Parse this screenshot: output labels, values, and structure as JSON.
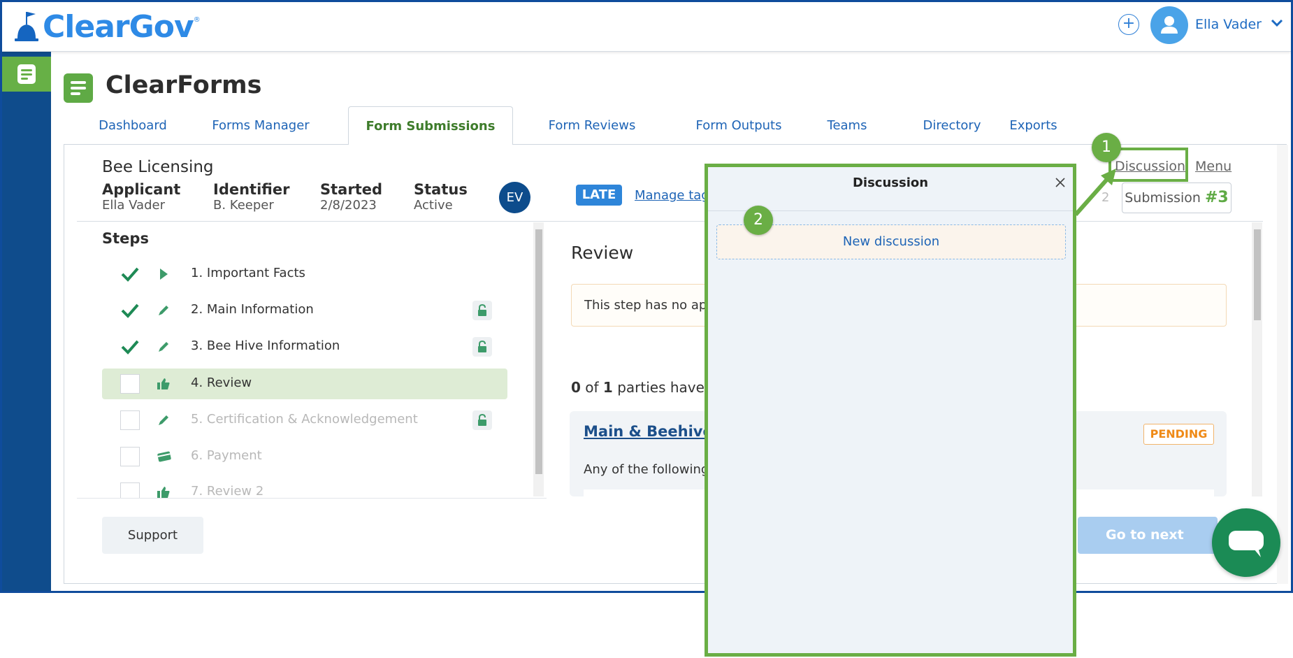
{
  "brand": {
    "name": "ClearGov",
    "reg": "®"
  },
  "header": {
    "user_name": "Ella Vader",
    "plus": "+"
  },
  "page": {
    "title": "ClearForms"
  },
  "tabs": [
    {
      "label": "Dashboard"
    },
    {
      "label": "Forms Manager"
    },
    {
      "label": "Form Submissions"
    },
    {
      "label": "Form Reviews"
    },
    {
      "label": "Form Outputs"
    },
    {
      "label": "Teams"
    },
    {
      "label": "Directory"
    },
    {
      "label": "Exports"
    }
  ],
  "submission": {
    "form_name": "Bee Licensing",
    "meta": [
      {
        "label": "Applicant",
        "value": "Ella Vader"
      },
      {
        "label": "Identifier",
        "value": "B. Keeper"
      },
      {
        "label": "Started",
        "value": "2/8/2023"
      },
      {
        "label": "Status",
        "value": "Active"
      }
    ],
    "initials": "EV",
    "late_badge": "LATE",
    "manage_tags": "Manage tags",
    "discussion_link": "Discussion",
    "menu_link": "Menu",
    "submission_label": "Submission",
    "submission_number": "#3",
    "faint_digit": "2"
  },
  "steps": {
    "title": "Steps",
    "items": [
      {
        "label": "1. Important Facts",
        "done": true,
        "icon": "play-icon",
        "locked": false,
        "active": false,
        "dim": false
      },
      {
        "label": "2. Main Information",
        "done": true,
        "icon": "pencil-icon",
        "locked": true,
        "active": false,
        "dim": false
      },
      {
        "label": "3. Bee Hive Information",
        "done": true,
        "icon": "pencil-icon",
        "locked": true,
        "active": false,
        "dim": false
      },
      {
        "label": "4. Review",
        "done": false,
        "icon": "thumbs-up-icon",
        "locked": false,
        "active": true,
        "dim": false
      },
      {
        "label": "5. Certification & Acknowledgement",
        "done": false,
        "icon": "pencil-icon",
        "locked": true,
        "active": false,
        "dim": true
      },
      {
        "label": "6. Payment",
        "done": false,
        "icon": "card-icon",
        "locked": false,
        "active": false,
        "dim": true
      },
      {
        "label": "7. Review 2",
        "done": false,
        "icon": "thumbs-up-icon",
        "locked": false,
        "active": false,
        "dim": true
      }
    ]
  },
  "review": {
    "title": "Review",
    "note": "This step has no ap",
    "parties_count": "0",
    "parties_of": " of ",
    "parties_total": "1",
    "parties_text": " parties have",
    "card_title": "Main & Beehive",
    "card_status": "PENDING",
    "card_text": "Any of the following"
  },
  "footer": {
    "support": "Support",
    "next": "Go to next step >"
  },
  "discussion_panel": {
    "title": "Discussion",
    "new_button": "New discussion"
  },
  "callouts": {
    "one": "1",
    "two": "2"
  },
  "colors": {
    "brand_blue": "#2e8ae6",
    "sidebar": "#0f4c8c",
    "accent_green": "#6aae45",
    "link": "#1e64b6",
    "pending": "#ef8a17"
  }
}
